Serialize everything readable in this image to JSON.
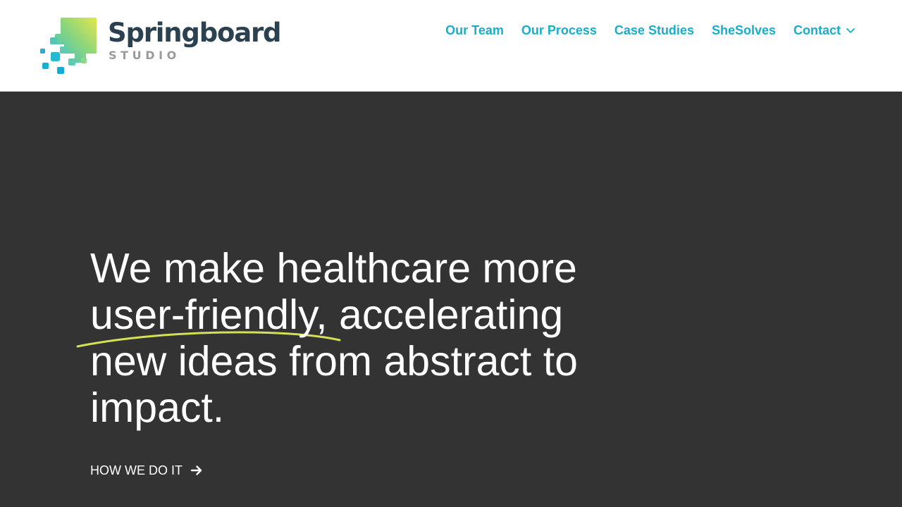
{
  "brand": {
    "name": "Springboard",
    "subtitle": "STUDIO"
  },
  "nav": {
    "items": [
      {
        "label": "Our Team"
      },
      {
        "label": "Our Process"
      },
      {
        "label": "Case Studies"
      },
      {
        "label": "SheSolves"
      },
      {
        "label": "Contact"
      }
    ]
  },
  "hero": {
    "headline_lines": [
      "We make healthcare more",
      "user-friendly, accelerating",
      "new ideas from abstract to",
      "impact."
    ],
    "cta_label": "HOW WE DO IT"
  },
  "colors": {
    "header_bg": "#ffffff",
    "hero_bg": "#333333",
    "nav_link": "#16aecb",
    "brand_text": "#2b4150",
    "brand_sub": "#9a9a9a",
    "underline_accent": "#d4e157",
    "hero_text": "#ffffff"
  },
  "icons": {
    "logo_mark": "springboard-pixel-logo-icon",
    "dropdown": "chevron-down-icon",
    "cta_arrow": "arrow-right-icon"
  }
}
